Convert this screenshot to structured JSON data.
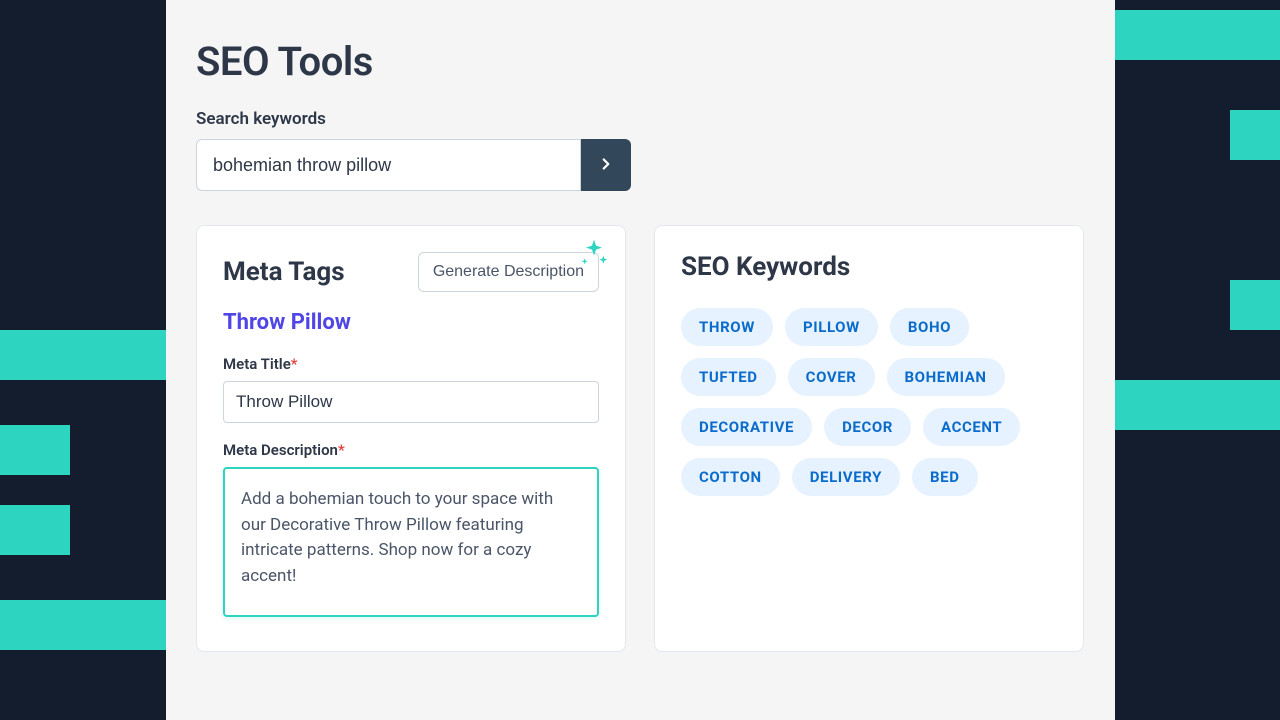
{
  "page": {
    "title": "SEO Tools"
  },
  "search": {
    "label": "Search keywords",
    "value": "bohemian throw pillow"
  },
  "meta_tags": {
    "card_title": "Meta Tags",
    "generate_label": "Generate Description",
    "product_name": "Throw Pillow",
    "title_label": "Meta Title",
    "title_value": "Throw Pillow",
    "description_label": "Meta Description",
    "description_value": "Add a bohemian touch to your space with our Decorative Throw Pillow featuring intricate patterns. Shop now for a cozy accent!"
  },
  "seo_keywords": {
    "card_title": "SEO Keywords",
    "chips": [
      "THROW",
      "PILLOW",
      "BOHO",
      "TUFTED",
      "COVER",
      "BOHEMIAN",
      "DECORATIVE",
      "DECOR",
      "ACCENT",
      "COTTON",
      "DELIVERY",
      "BED"
    ]
  },
  "glyphs": {
    "required": "*"
  }
}
